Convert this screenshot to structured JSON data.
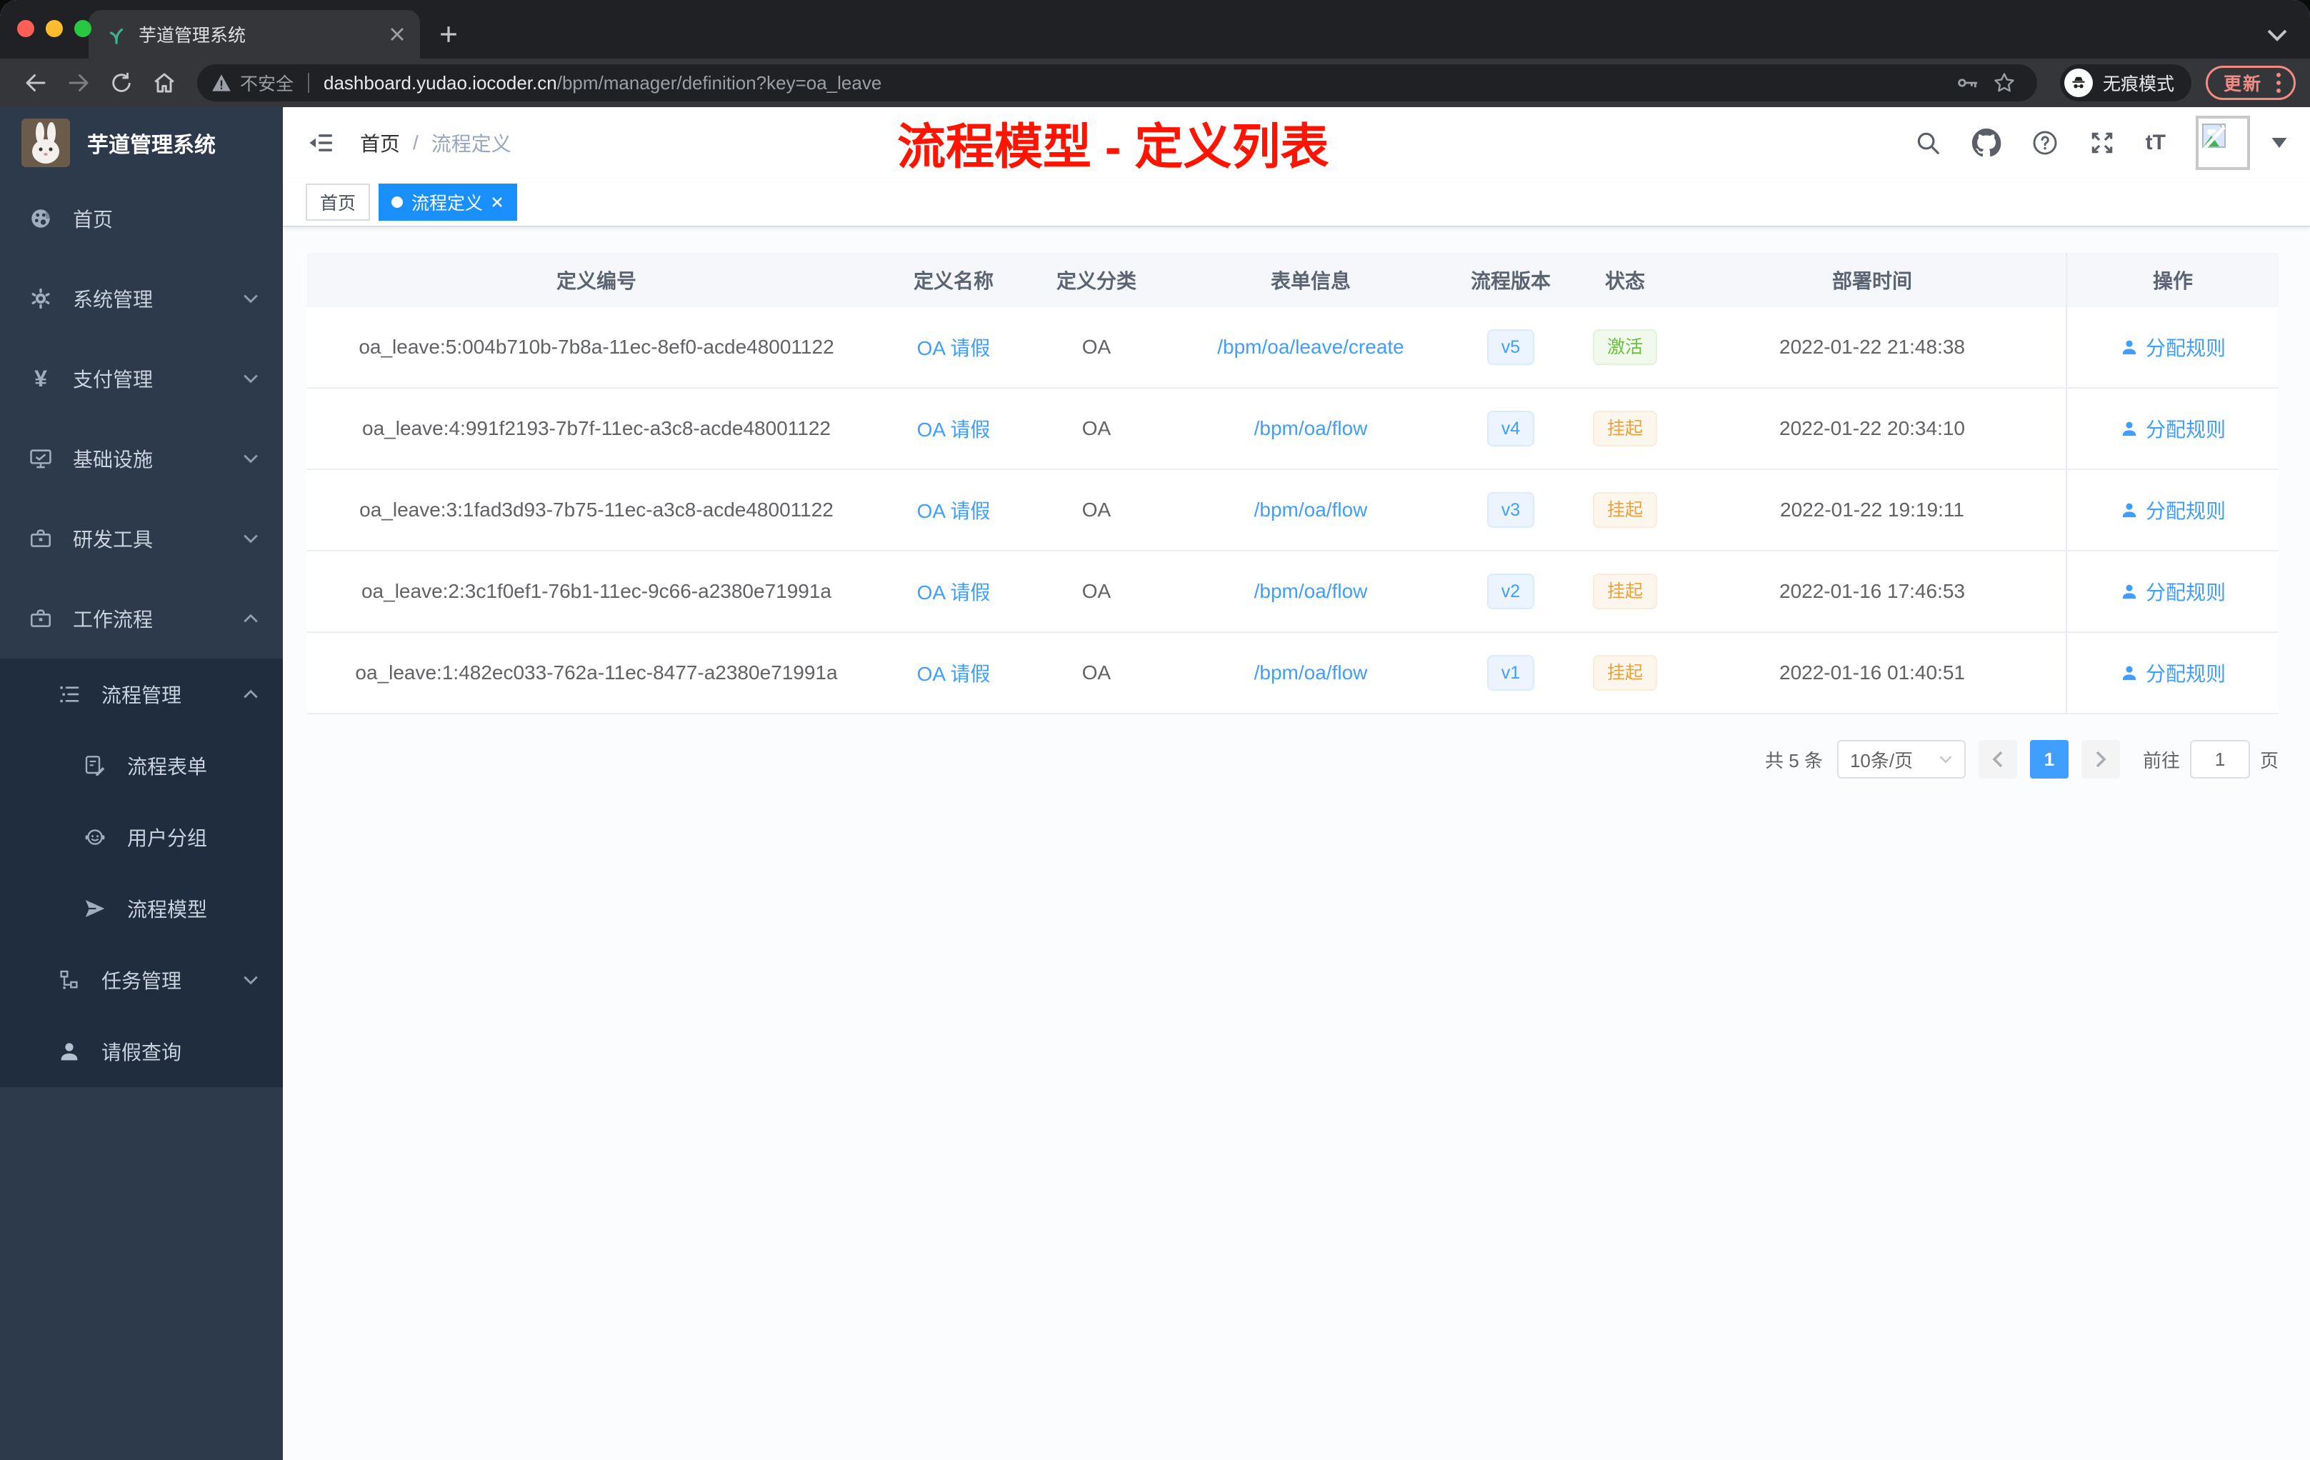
{
  "browser": {
    "tab_title": "芋道管理系统",
    "security_label": "不安全",
    "url_host": "dashboard.yudao.iocoder.cn",
    "url_path": "/bpm/manager/definition?key=oa_leave",
    "incognito_label": "无痕模式",
    "update_label": "更新"
  },
  "sidebar": {
    "app_title": "芋道管理系统",
    "items": [
      {
        "label": "首页"
      },
      {
        "label": "系统管理"
      },
      {
        "label": "支付管理"
      },
      {
        "label": "基础设施"
      },
      {
        "label": "研发工具"
      },
      {
        "label": "工作流程"
      },
      {
        "label": "流程管理"
      },
      {
        "label": "流程表单"
      },
      {
        "label": "用户分组"
      },
      {
        "label": "流程模型"
      },
      {
        "label": "任务管理"
      },
      {
        "label": "请假查询"
      }
    ]
  },
  "navbar": {
    "breadcrumb_home": "首页",
    "breadcrumb_sep": "/",
    "breadcrumb_current": "流程定义"
  },
  "annotation": {
    "text": "流程模型 - 定义列表"
  },
  "tags": {
    "home": {
      "label": "首页"
    },
    "process": {
      "label": "流程定义"
    }
  },
  "table": {
    "columns": [
      "定义编号",
      "定义名称",
      "定义分类",
      "表单信息",
      "流程版本",
      "状态",
      "部署时间",
      "操作"
    ],
    "rows": [
      {
        "id": "oa_leave:5:004b710b-7b8a-11ec-8ef0-acde48001122",
        "name": "OA 请假",
        "category": "OA",
        "form": "/bpm/oa/leave/create",
        "version": "v5",
        "status": "激活",
        "time": "2022-01-22 21:48:38",
        "action": "分配规则"
      },
      {
        "id": "oa_leave:4:991f2193-7b7f-11ec-a3c8-acde48001122",
        "name": "OA 请假",
        "category": "OA",
        "form": "/bpm/oa/flow",
        "version": "v4",
        "status": "挂起",
        "time": "2022-01-22 20:34:10",
        "action": "分配规则"
      },
      {
        "id": "oa_leave:3:1fad3d93-7b75-11ec-a3c8-acde48001122",
        "name": "OA 请假",
        "category": "OA",
        "form": "/bpm/oa/flow",
        "version": "v3",
        "status": "挂起",
        "time": "2022-01-22 19:19:11",
        "action": "分配规则"
      },
      {
        "id": "oa_leave:2:3c1f0ef1-76b1-11ec-9c66-a2380e71991a",
        "name": "OA 请假",
        "category": "OA",
        "form": "/bpm/oa/flow",
        "version": "v2",
        "status": "挂起",
        "time": "2022-01-16 17:46:53",
        "action": "分配规则"
      },
      {
        "id": "oa_leave:1:482ec033-762a-11ec-8477-a2380e71991a",
        "name": "OA 请假",
        "category": "OA",
        "form": "/bpm/oa/flow",
        "version": "v1",
        "status": "挂起",
        "time": "2022-01-16 01:40:51",
        "action": "分配规则"
      }
    ]
  },
  "pagination": {
    "total_label": "共 5 条",
    "size_label": "10条/页",
    "current_page": "1",
    "goto_label": "前往",
    "goto_value": "1",
    "unit_label": "页"
  }
}
